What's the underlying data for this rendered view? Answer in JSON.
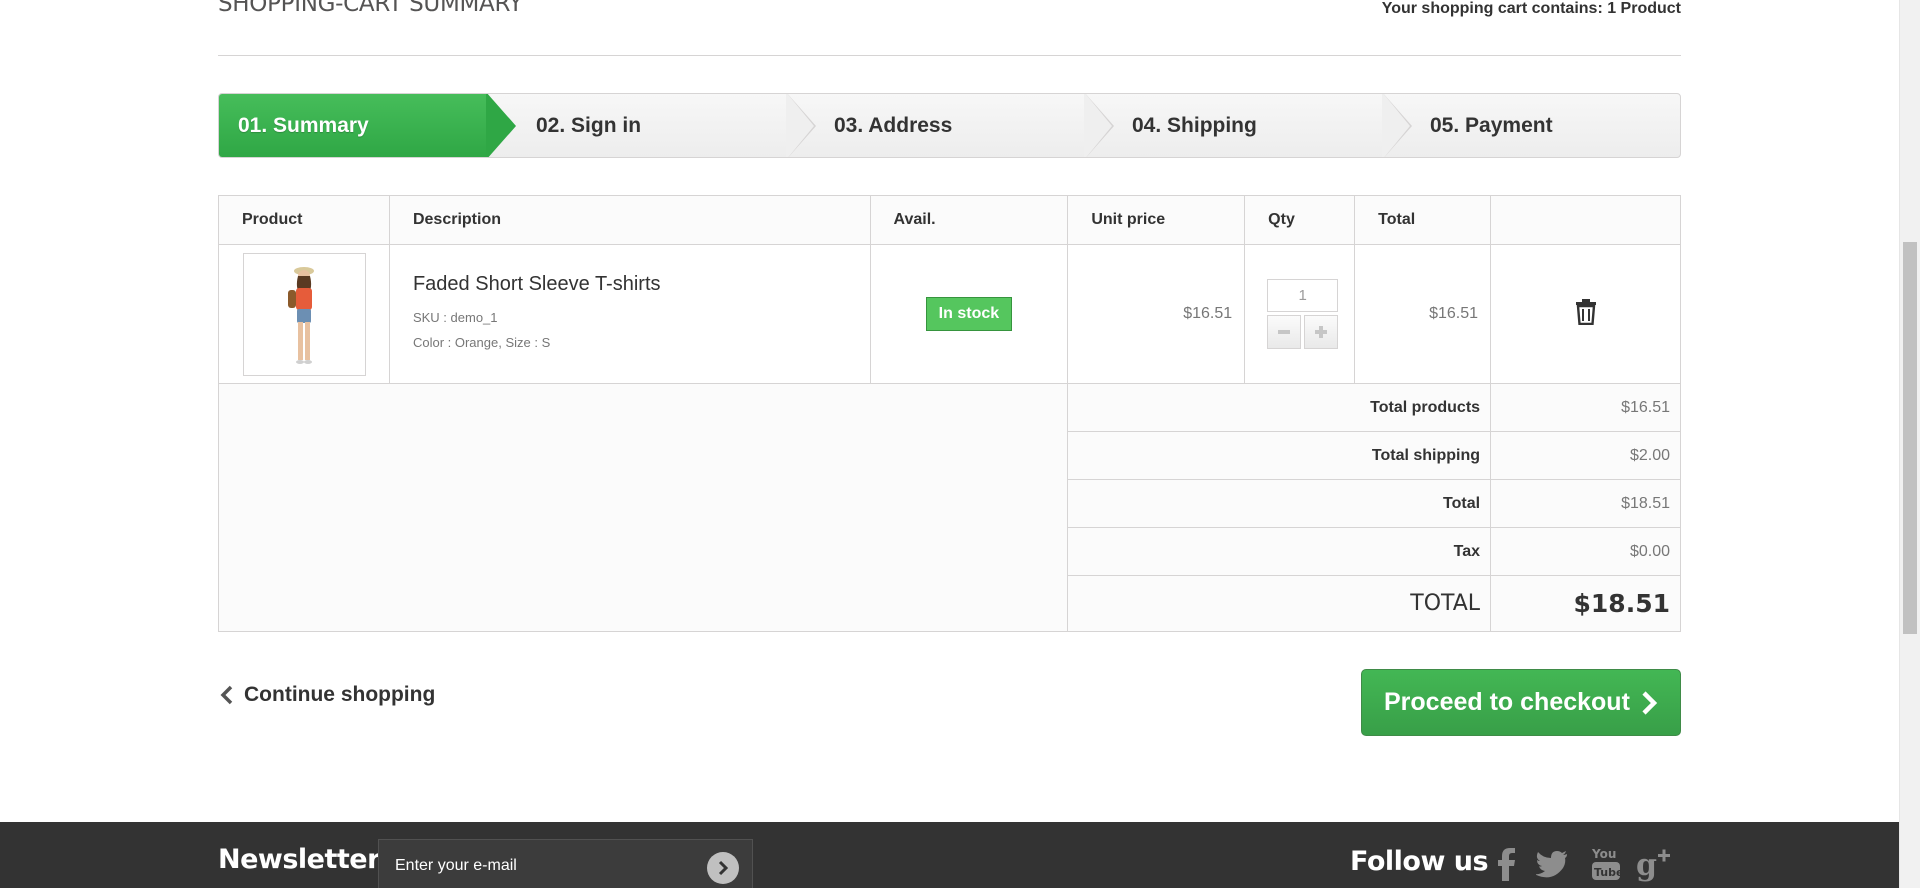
{
  "heading": {
    "title": "Shopping-cart summary",
    "counter": "Your shopping cart contains: 1 Product"
  },
  "steps": [
    {
      "label": "01. Summary",
      "current": true
    },
    {
      "label": "02. Sign in",
      "current": false
    },
    {
      "label": "03. Address",
      "current": false
    },
    {
      "label": "04. Shipping",
      "current": false
    },
    {
      "label": "05. Payment",
      "current": false
    }
  ],
  "table": {
    "headers": [
      "Product",
      "Description",
      "Avail.",
      "Unit price",
      "Qty",
      "Total",
      ""
    ],
    "item": {
      "name": "Faded Short Sleeve T-shirts",
      "sku": "SKU : demo_1",
      "attributes": "Color : Orange, Size : S",
      "availability": "In stock",
      "unit_price": "$16.51",
      "qty": "1",
      "total": "$16.51",
      "delete_icon": "trash-icon"
    },
    "totals": [
      {
        "label": "Total products",
        "value": "$16.51"
      },
      {
        "label": "Total shipping",
        "value": "$2.00"
      },
      {
        "label": "Total",
        "value": "$18.51"
      },
      {
        "label": "Tax",
        "value": "$0.00"
      }
    ],
    "grand_total": {
      "label": "Total",
      "value": "$18.51"
    }
  },
  "nav": {
    "continue": "Continue shopping",
    "checkout": "Proceed to checkout"
  },
  "footer": {
    "newsletter_title": "Newsletter",
    "newsletter_placeholder": "Enter your e-mail",
    "follow_title": "Follow us",
    "social": [
      "facebook-icon",
      "twitter-icon",
      "youtube-icon",
      "google-plus-icon"
    ]
  },
  "colors": {
    "accent_green": "#3aae4c",
    "footer_bg": "#333333"
  }
}
